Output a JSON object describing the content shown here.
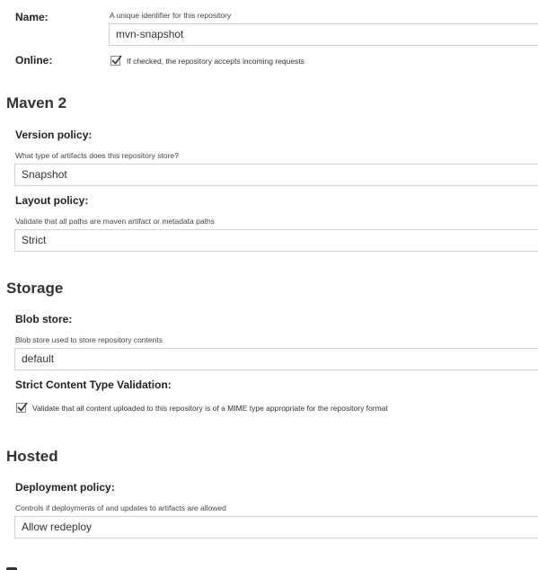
{
  "general": {
    "name_label": "Name:",
    "name_hint": "A unique identifier for this repository",
    "name_value": "mvn-snapshot",
    "online_label": "Online:",
    "online_checked": true,
    "online_text": "If checked, the repository accepts incoming requests"
  },
  "maven": {
    "title": "Maven 2",
    "version_label": "Version policy:",
    "version_hint": "What type of artifacts does this repository store?",
    "version_value": "Snapshot",
    "layout_label": "Layout policy:",
    "layout_hint": "Validate that all paths are maven artifact or metadata paths",
    "layout_value": "Strict"
  },
  "storage": {
    "title": "Storage",
    "blob_label": "Blob store:",
    "blob_hint": "Blob store used to store repository contents",
    "blob_value": "default",
    "strict_label": "Strict Content Type Validation:",
    "strict_checked": true,
    "strict_text": "Validate that all content uploaded to this repository is of a MIME type appropriate for the repository format"
  },
  "hosted": {
    "title": "Hosted",
    "deploy_label": "Deployment policy:",
    "deploy_hint": "Controls if deployments of and updates to artifacts are allowed",
    "deploy_value": "Allow redeploy"
  },
  "icons": {
    "check": "checkmark-icon"
  }
}
